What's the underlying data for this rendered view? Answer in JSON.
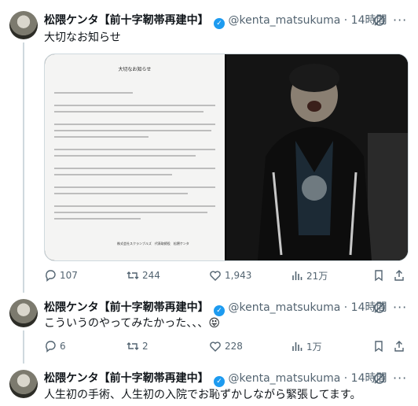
{
  "tweets": [
    {
      "author_name": "松隈ケンタ【前十字靭帯再建中】",
      "handle": "@kenta_matsukuma",
      "time": "14時間",
      "text": "大切なお知らせ",
      "media": {
        "document_title": "大切なお知らせ",
        "document_signature": "株式会社スクランブルズ　代表取締役　松隈ケンタ"
      },
      "stats": {
        "replies": "107",
        "retweets": "244",
        "likes": "1,943",
        "views": "21万"
      }
    },
    {
      "author_name": "松隈ケンタ【前十字靭帯再建中】",
      "handle": "@kenta_matsukuma",
      "time": "14時間",
      "text": "こういうのやってみたかった、、、",
      "emoji": "😝",
      "stats": {
        "replies": "6",
        "retweets": "2",
        "likes": "228",
        "views": "1万"
      }
    },
    {
      "author_name": "松隈ケンタ【前十字靭帯再建中】",
      "handle": "@kenta_matsukuma",
      "time": "14時間",
      "text": "人生初の手術、人生初の入院でお恥ずかしながら緊張してます。"
    }
  ],
  "icons": {
    "verified": "verified-badge-icon",
    "grok": "grok-icon",
    "more": "more-icon",
    "reply": "reply-icon",
    "retweet": "retweet-icon",
    "like": "heart-icon",
    "views": "views-icon",
    "bookmark": "bookmark-icon",
    "share": "share-icon"
  },
  "colors": {
    "verified": "#1d9bf0",
    "muted": "#536471",
    "text": "#0f1419"
  }
}
